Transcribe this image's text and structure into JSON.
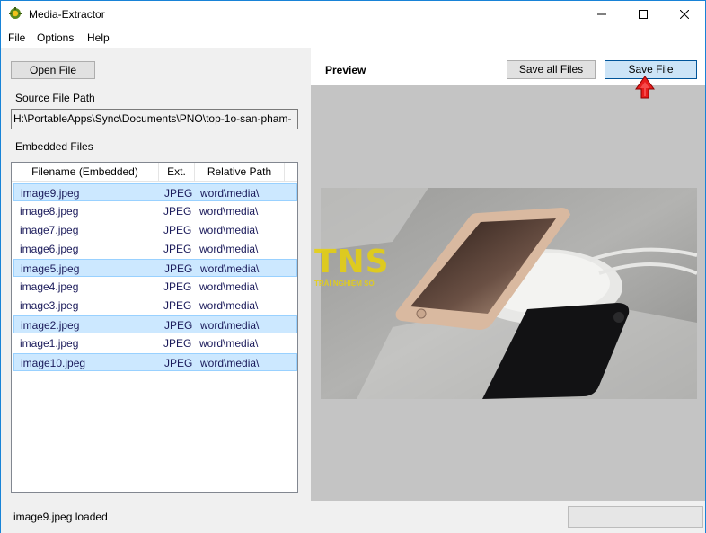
{
  "window": {
    "title": "Media-Extractor",
    "accent": "#1883d7"
  },
  "menu": {
    "file": "File",
    "options": "Options",
    "help": "Help"
  },
  "left": {
    "open_button": "Open File",
    "source_label": "Source File Path",
    "source_path": "H:\\PortableApps\\Sync\\Documents\\PNO\\top-1o-san-pham-",
    "embedded_label": "Embedded Files",
    "columns": [
      "Filename (Embedded)",
      "Ext.",
      "Relative Path"
    ],
    "rows": [
      {
        "name": "image9.jpeg",
        "ext": "JPEG",
        "path": "word\\media\\",
        "selected": true
      },
      {
        "name": "image8.jpeg",
        "ext": "JPEG",
        "path": "word\\media\\",
        "selected": false
      },
      {
        "name": "image7.jpeg",
        "ext": "JPEG",
        "path": "word\\media\\",
        "selected": false
      },
      {
        "name": "image6.jpeg",
        "ext": "JPEG",
        "path": "word\\media\\",
        "selected": false
      },
      {
        "name": "image5.jpeg",
        "ext": "JPEG",
        "path": "word\\media\\",
        "selected": true
      },
      {
        "name": "image4.jpeg",
        "ext": "JPEG",
        "path": "word\\media\\",
        "selected": false
      },
      {
        "name": "image3.jpeg",
        "ext": "JPEG",
        "path": "word\\media\\",
        "selected": false
      },
      {
        "name": "image2.jpeg",
        "ext": "JPEG",
        "path": "word\\media\\",
        "selected": true
      },
      {
        "name": "image1.jpeg",
        "ext": "JPEG",
        "path": "word\\media\\",
        "selected": false
      },
      {
        "name": "image10.jpeg",
        "ext": "JPEG",
        "path": "word\\media\\",
        "selected": true
      }
    ]
  },
  "right": {
    "preview_label": "Preview",
    "save_all_button": "Save all Files",
    "save_file_button": "Save File",
    "watermark_main": "TNS",
    "watermark_sub": "TRẢI NGHIỆM SỐ"
  },
  "status": {
    "text": "image9.jpeg loaded",
    "progress": 0
  }
}
